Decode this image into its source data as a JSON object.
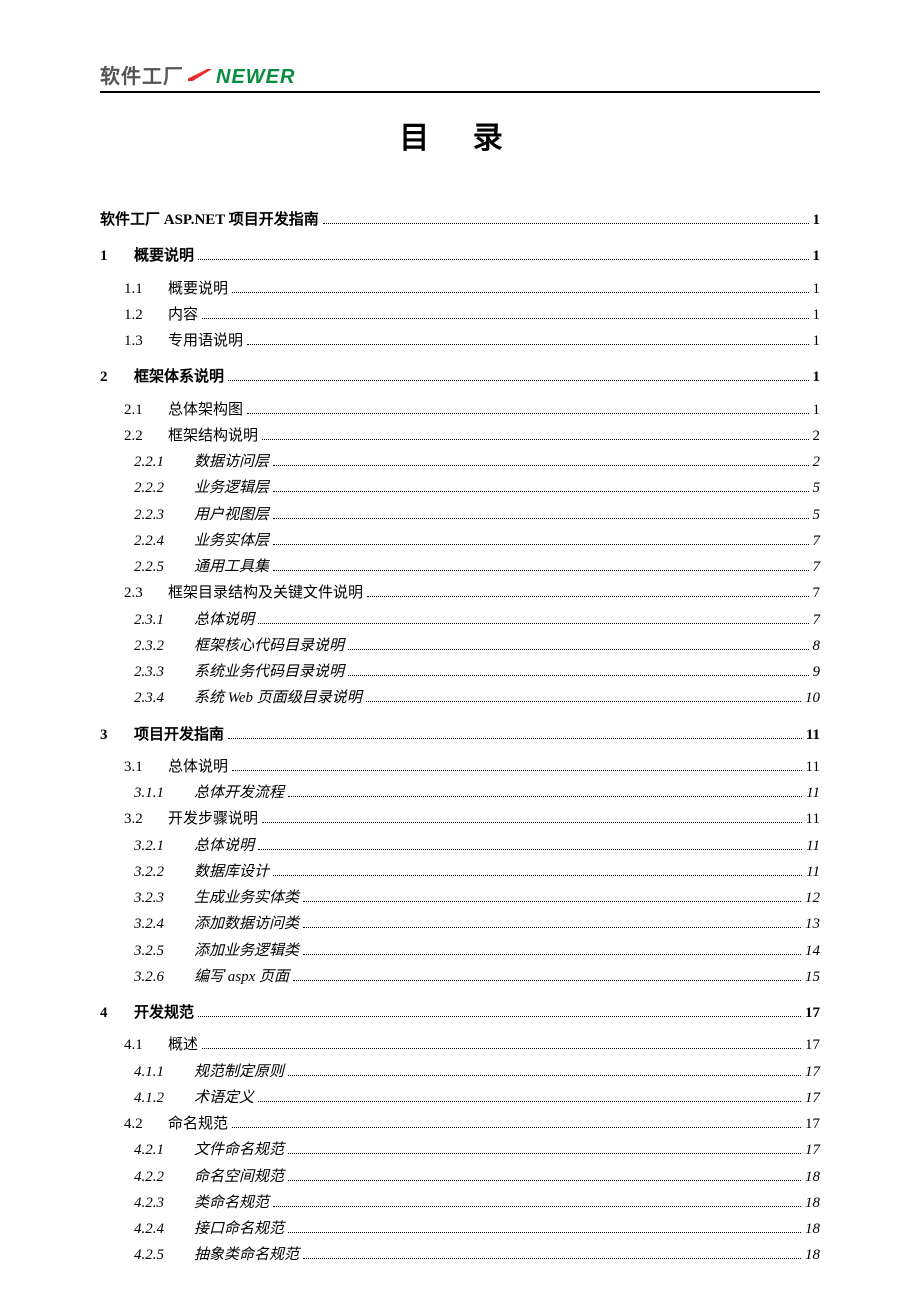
{
  "header": {
    "logo_cn": "软件工厂",
    "logo_en": "NEWER"
  },
  "title": "目 录",
  "toc": {
    "entries": [
      {
        "level": 0,
        "num": "",
        "label": "软件工厂 ASP.NET 项目开发指南",
        "page": "1"
      },
      {
        "level": 1,
        "num": "1",
        "label": "概要说明",
        "page": "1"
      },
      {
        "level": 2,
        "num": "1.1",
        "label": "概要说明",
        "page": "1"
      },
      {
        "level": 2,
        "num": "1.2",
        "label": "内容",
        "page": "1"
      },
      {
        "level": 2,
        "num": "1.3",
        "label": "专用语说明",
        "page": "1"
      },
      {
        "level": 1,
        "num": "2",
        "label": "框架体系说明",
        "page": "1"
      },
      {
        "level": 2,
        "num": "2.1",
        "label": "总体架构图",
        "page": "1"
      },
      {
        "level": 2,
        "num": "2.2",
        "label": "框架结构说明",
        "page": "2"
      },
      {
        "level": 3,
        "num": "2.2.1",
        "label": "数据访问层",
        "page": "2"
      },
      {
        "level": 3,
        "num": "2.2.2",
        "label": "业务逻辑层",
        "page": "5"
      },
      {
        "level": 3,
        "num": "2.2.3",
        "label": "用户视图层",
        "page": "5"
      },
      {
        "level": 3,
        "num": "2.2.4",
        "label": "业务实体层",
        "page": "7"
      },
      {
        "level": 3,
        "num": "2.2.5",
        "label": "通用工具集",
        "page": "7"
      },
      {
        "level": 2,
        "num": "2.3",
        "label": "框架目录结构及关键文件说明",
        "page": "7"
      },
      {
        "level": 3,
        "num": "2.3.1",
        "label": "总体说明",
        "page": "7"
      },
      {
        "level": 3,
        "num": "2.3.2",
        "label": "框架核心代码目录说明",
        "page": "8"
      },
      {
        "level": 3,
        "num": "2.3.3",
        "label": "系统业务代码目录说明",
        "page": "9"
      },
      {
        "level": 3,
        "num": "2.3.4",
        "label": "系统 Web 页面级目录说明",
        "page": "10"
      },
      {
        "level": 1,
        "num": "3",
        "label": "项目开发指南",
        "page": "11"
      },
      {
        "level": 2,
        "num": "3.1",
        "label": "总体说明",
        "page": "11"
      },
      {
        "level": 3,
        "num": "3.1.1",
        "label": "总体开发流程",
        "page": "11"
      },
      {
        "level": 2,
        "num": "3.2",
        "label": "开发步骤说明",
        "page": "11"
      },
      {
        "level": 3,
        "num": "3.2.1",
        "label": "总体说明",
        "page": "11"
      },
      {
        "level": 3,
        "num": "3.2.2",
        "label": "数据库设计",
        "page": "11"
      },
      {
        "level": 3,
        "num": "3.2.3",
        "label": "生成业务实体类",
        "page": "12"
      },
      {
        "level": 3,
        "num": "3.2.4",
        "label": "添加数据访问类",
        "page": "13"
      },
      {
        "level": 3,
        "num": "3.2.5",
        "label": "添加业务逻辑类",
        "page": "14"
      },
      {
        "level": 3,
        "num": "3.2.6",
        "label": "编写 aspx 页面",
        "page": "15"
      },
      {
        "level": 1,
        "num": "4",
        "label": "开发规范",
        "page": "17"
      },
      {
        "level": 2,
        "num": "4.1",
        "label": "概述",
        "page": "17"
      },
      {
        "level": 3,
        "num": "4.1.1",
        "label": "规范制定原则",
        "page": "17"
      },
      {
        "level": 3,
        "num": "4.1.2",
        "label": "术语定义",
        "page": "17"
      },
      {
        "level": 2,
        "num": "4.2",
        "label": "命名规范",
        "page": "17"
      },
      {
        "level": 3,
        "num": "4.2.1",
        "label": "文件命名规范",
        "page": "17"
      },
      {
        "level": 3,
        "num": "4.2.2",
        "label": "命名空间规范",
        "page": "18"
      },
      {
        "level": 3,
        "num": "4.2.3",
        "label": "类命名规范",
        "page": "18"
      },
      {
        "level": 3,
        "num": "4.2.4",
        "label": "接口命名规范",
        "page": "18"
      },
      {
        "level": 3,
        "num": "4.2.5",
        "label": "抽象类命名规范",
        "page": "18"
      }
    ]
  }
}
